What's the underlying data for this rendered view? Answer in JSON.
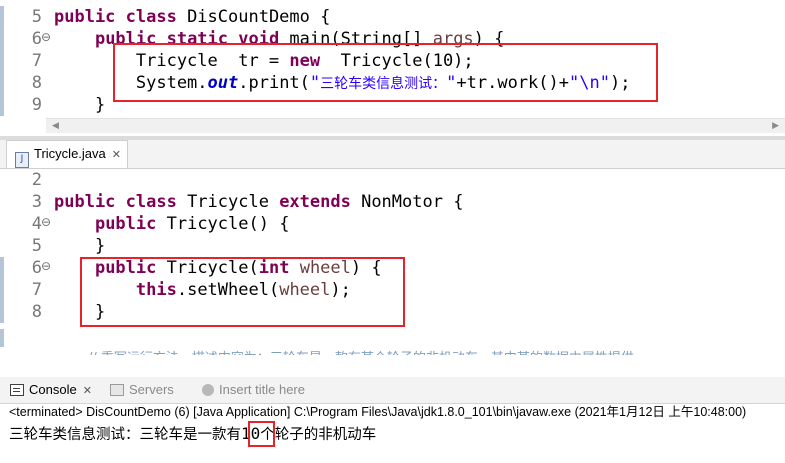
{
  "top_editor": {
    "lines": [
      {
        "num": "5",
        "tokens": [
          {
            "t": "public class",
            "c": "kw"
          },
          {
            "t": " DisCountDemo {",
            "c": ""
          }
        ]
      },
      {
        "num": "6",
        "fold": "⊖",
        "tokens": [
          {
            "t": "    ",
            "c": ""
          },
          {
            "t": "public static void",
            "c": "kw"
          },
          {
            "t": " main(String[] ",
            "c": ""
          },
          {
            "t": "args",
            "c": "prm"
          },
          {
            "t": ") {",
            "c": ""
          }
        ]
      },
      {
        "num": "7",
        "tokens": [
          {
            "t": "        Tricycle  tr = ",
            "c": ""
          },
          {
            "t": "new",
            "c": "kw"
          },
          {
            "t": "  Tricycle(10);",
            "c": ""
          }
        ]
      },
      {
        "num": "8",
        "tokens": [
          {
            "t": "        System.",
            "c": ""
          },
          {
            "t": "out",
            "c": "fld"
          },
          {
            "t": ".print(",
            "c": ""
          },
          {
            "t": "\"",
            "c": "str"
          },
          {
            "t": "三轮车类信息测试：",
            "c": "str cjk"
          },
          {
            "t": "\"",
            "c": "str"
          },
          {
            "t": "+tr.work()+",
            "c": ""
          },
          {
            "t": "\"\\n\"",
            "c": "str"
          },
          {
            "t": ");",
            "c": ""
          }
        ]
      },
      {
        "num": "9",
        "tokens": [
          {
            "t": "    }",
            "c": ""
          }
        ]
      }
    ]
  },
  "tab": {
    "label": "Tricycle.java",
    "close": "✕",
    "icon": "J"
  },
  "bottom_editor": {
    "lines": [
      {
        "num": "2",
        "tokens": []
      },
      {
        "num": "3",
        "tokens": [
          {
            "t": "public class",
            "c": "kw"
          },
          {
            "t": " Tricycle ",
            "c": ""
          },
          {
            "t": "extends",
            "c": "kw"
          },
          {
            "t": " NonMotor {",
            "c": ""
          }
        ]
      },
      {
        "num": "4",
        "fold": "⊖",
        "tokens": [
          {
            "t": "    ",
            "c": ""
          },
          {
            "t": "public",
            "c": "kw"
          },
          {
            "t": " Tricycle() {",
            "c": ""
          }
        ]
      },
      {
        "num": "5",
        "tokens": [
          {
            "t": "    }",
            "c": ""
          }
        ]
      },
      {
        "num": "6",
        "fold": "⊖",
        "tokens": [
          {
            "t": "    ",
            "c": ""
          },
          {
            "t": "public",
            "c": "kw"
          },
          {
            "t": " Tricycle(",
            "c": ""
          },
          {
            "t": "int",
            "c": "kw"
          },
          {
            "t": " ",
            "c": ""
          },
          {
            "t": "wheel",
            "c": "prm"
          },
          {
            "t": ") {",
            "c": ""
          }
        ]
      },
      {
        "num": "7",
        "tokens": [
          {
            "t": "        ",
            "c": ""
          },
          {
            "t": "this",
            "c": "kw"
          },
          {
            "t": ".setWheel(",
            "c": ""
          },
          {
            "t": "wheel",
            "c": "prm"
          },
          {
            "t": ");",
            "c": ""
          }
        ]
      },
      {
        "num": "8",
        "tokens": [
          {
            "t": "    }",
            "c": ""
          }
        ]
      }
    ],
    "partial_comment": "// 重写运行方法，描述内容为：三轮车是一款有某个轮子的非机动车，其中某的数据由属性提供"
  },
  "console": {
    "tabs": [
      {
        "label": "Console",
        "close": "✕",
        "active": true
      },
      {
        "label": "Servers",
        "active": false
      },
      {
        "label": "Insert title here",
        "active": false
      }
    ],
    "terminated_line": "<terminated> DisCountDemo (6) [Java Application] C:\\Program Files\\Java\\jdk1.8.0_101\\bin\\javaw.exe (2021年1月12日 上午10:48:00)",
    "output_prefix": "三轮车类信息测试：三轮车是一款有",
    "output_number": "10",
    "output_suffix": "个轮子的非机动车"
  },
  "colors": {
    "keyword": "#7f0055",
    "string": "#2a00ff",
    "field": "#0000c0",
    "param": "#6a3e3e",
    "highlight_box": "#e8222b"
  }
}
